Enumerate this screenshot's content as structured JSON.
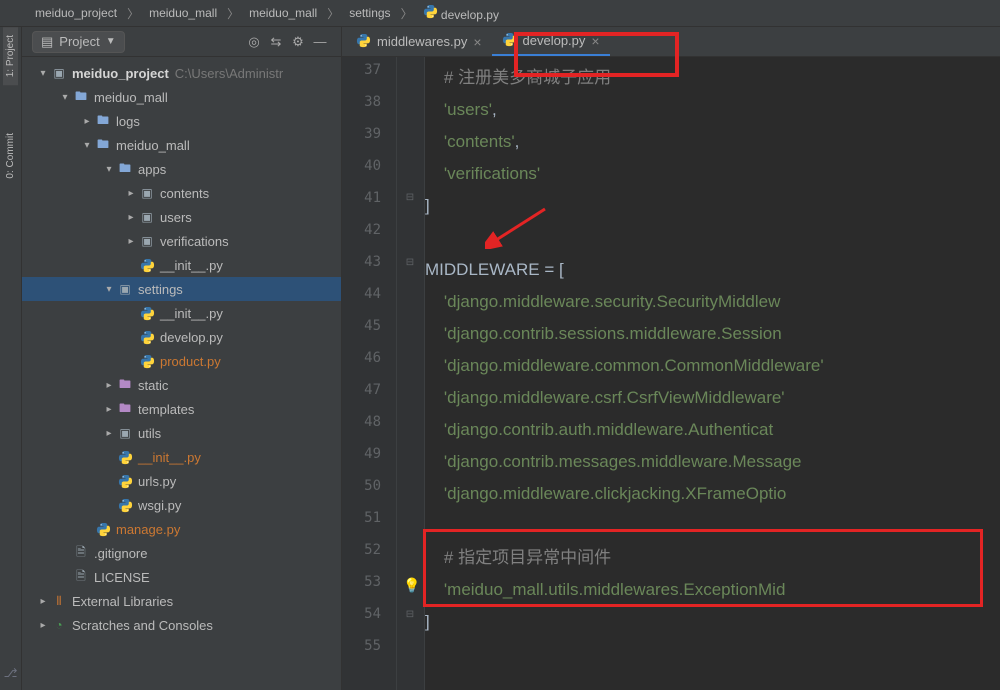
{
  "breadcrumb": [
    "meiduo_project",
    "meiduo_mall",
    "meiduo_mall",
    "settings",
    "develop.py"
  ],
  "left_rail": {
    "project": "1: Project",
    "commit": "0: Commit"
  },
  "proj_header": {
    "label": "Project"
  },
  "tabs": [
    {
      "label": "middlewares.py",
      "active": false
    },
    {
      "label": "develop.py",
      "active": true
    }
  ],
  "tree": [
    {
      "ind": 0,
      "arrow": "▾",
      "icon": "dir-root",
      "label": "meiduo_project",
      "bold": true,
      "muted": "C:\\Users\\Administr"
    },
    {
      "ind": 1,
      "arrow": "▾",
      "icon": "dir",
      "label": "meiduo_mall"
    },
    {
      "ind": 2,
      "arrow": "▸",
      "icon": "dir",
      "label": "logs"
    },
    {
      "ind": 2,
      "arrow": "▾",
      "icon": "dir",
      "label": "meiduo_mall"
    },
    {
      "ind": 3,
      "arrow": "▾",
      "icon": "dir",
      "label": "apps"
    },
    {
      "ind": 4,
      "arrow": "▸",
      "icon": "dir-pkg",
      "label": "contents"
    },
    {
      "ind": 4,
      "arrow": "▸",
      "icon": "dir-pkg",
      "label": "users"
    },
    {
      "ind": 4,
      "arrow": "▸",
      "icon": "dir-pkg",
      "label": "verifications"
    },
    {
      "ind": 4,
      "arrow": "",
      "icon": "py",
      "label": "__init__.py"
    },
    {
      "ind": 3,
      "arrow": "▾",
      "icon": "dir-pkg",
      "label": "settings",
      "selected": true
    },
    {
      "ind": 4,
      "arrow": "",
      "icon": "py",
      "label": "__init__.py"
    },
    {
      "ind": 4,
      "arrow": "",
      "icon": "py",
      "label": "develop.py"
    },
    {
      "ind": 4,
      "arrow": "",
      "icon": "py",
      "label": "product.py",
      "orange": true
    },
    {
      "ind": 3,
      "arrow": "▸",
      "icon": "dir-res",
      "label": "static"
    },
    {
      "ind": 3,
      "arrow": "▸",
      "icon": "dir-tpl",
      "label": "templates"
    },
    {
      "ind": 3,
      "arrow": "▸",
      "icon": "dir-pkg",
      "label": "utils"
    },
    {
      "ind": 3,
      "arrow": "",
      "icon": "py",
      "label": "__init__.py",
      "orange": true
    },
    {
      "ind": 3,
      "arrow": "",
      "icon": "py",
      "label": "urls.py"
    },
    {
      "ind": 3,
      "arrow": "",
      "icon": "py",
      "label": "wsgi.py"
    },
    {
      "ind": 2,
      "arrow": "",
      "icon": "py",
      "label": "manage.py",
      "orange": true
    },
    {
      "ind": 1,
      "arrow": "",
      "icon": "file",
      "label": ".gitignore"
    },
    {
      "ind": 1,
      "arrow": "",
      "icon": "file",
      "label": "LICENSE"
    },
    {
      "ind": 0,
      "arrow": "▸",
      "icon": "lib",
      "label": "External Libraries"
    },
    {
      "ind": 0,
      "arrow": "▸",
      "icon": "scratch",
      "label": "Scratches and Consoles"
    }
  ],
  "line_start": 37,
  "code": [
    {
      "tokens": [
        {
          "t": "    ",
          "c": ""
        },
        {
          "t": "# 注册美多商城子应用",
          "c": "s-comment"
        }
      ]
    },
    {
      "tokens": [
        {
          "t": "    ",
          "c": ""
        },
        {
          "t": "'users'",
          "c": "s-string"
        },
        {
          "t": ",",
          "c": "s-var"
        }
      ]
    },
    {
      "tokens": [
        {
          "t": "    ",
          "c": ""
        },
        {
          "t": "'contents'",
          "c": "s-string"
        },
        {
          "t": ",",
          "c": "s-var"
        }
      ]
    },
    {
      "tokens": [
        {
          "t": "    ",
          "c": ""
        },
        {
          "t": "'verifications'",
          "c": "s-string"
        }
      ]
    },
    {
      "tokens": [
        {
          "t": "]",
          "c": "s-var"
        }
      ]
    },
    {
      "tokens": [
        {
          "t": "",
          "c": ""
        }
      ]
    },
    {
      "tokens": [
        {
          "t": "MIDDLEWARE = [",
          "c": "s-var"
        }
      ]
    },
    {
      "tokens": [
        {
          "t": "    ",
          "c": ""
        },
        {
          "t": "'django.middleware.security.SecurityMiddlew",
          "c": "s-string"
        }
      ]
    },
    {
      "tokens": [
        {
          "t": "    ",
          "c": ""
        },
        {
          "t": "'django.contrib.sessions.middleware.Session",
          "c": "s-string"
        }
      ]
    },
    {
      "tokens": [
        {
          "t": "    ",
          "c": ""
        },
        {
          "t": "'django.middleware.common.CommonMiddleware'",
          "c": "s-string"
        }
      ]
    },
    {
      "tokens": [
        {
          "t": "    ",
          "c": ""
        },
        {
          "t": "'django.middleware.csrf.CsrfViewMiddleware'",
          "c": "s-string"
        }
      ]
    },
    {
      "tokens": [
        {
          "t": "    ",
          "c": ""
        },
        {
          "t": "'django.contrib.auth.middleware.Authenticat",
          "c": "s-string"
        }
      ]
    },
    {
      "tokens": [
        {
          "t": "    ",
          "c": ""
        },
        {
          "t": "'django.contrib.messages.middleware.Message",
          "c": "s-string"
        }
      ]
    },
    {
      "tokens": [
        {
          "t": "    ",
          "c": ""
        },
        {
          "t": "'django.middleware.clickjacking.XFrameOptio",
          "c": "s-string"
        }
      ]
    },
    {
      "tokens": [
        {
          "t": "",
          "c": ""
        }
      ]
    },
    {
      "tokens": [
        {
          "t": "    ",
          "c": ""
        },
        {
          "t": "# 指定项目异常中间件",
          "c": "s-comment"
        }
      ]
    },
    {
      "tokens": [
        {
          "t": "    ",
          "c": ""
        },
        {
          "t": "'meiduo_mall.utils.middlewares.ExceptionMid",
          "c": "s-string"
        }
      ]
    },
    {
      "tokens": [
        {
          "t": "]",
          "c": "s-var"
        }
      ]
    },
    {
      "tokens": [
        {
          "t": "",
          "c": ""
        }
      ]
    }
  ]
}
